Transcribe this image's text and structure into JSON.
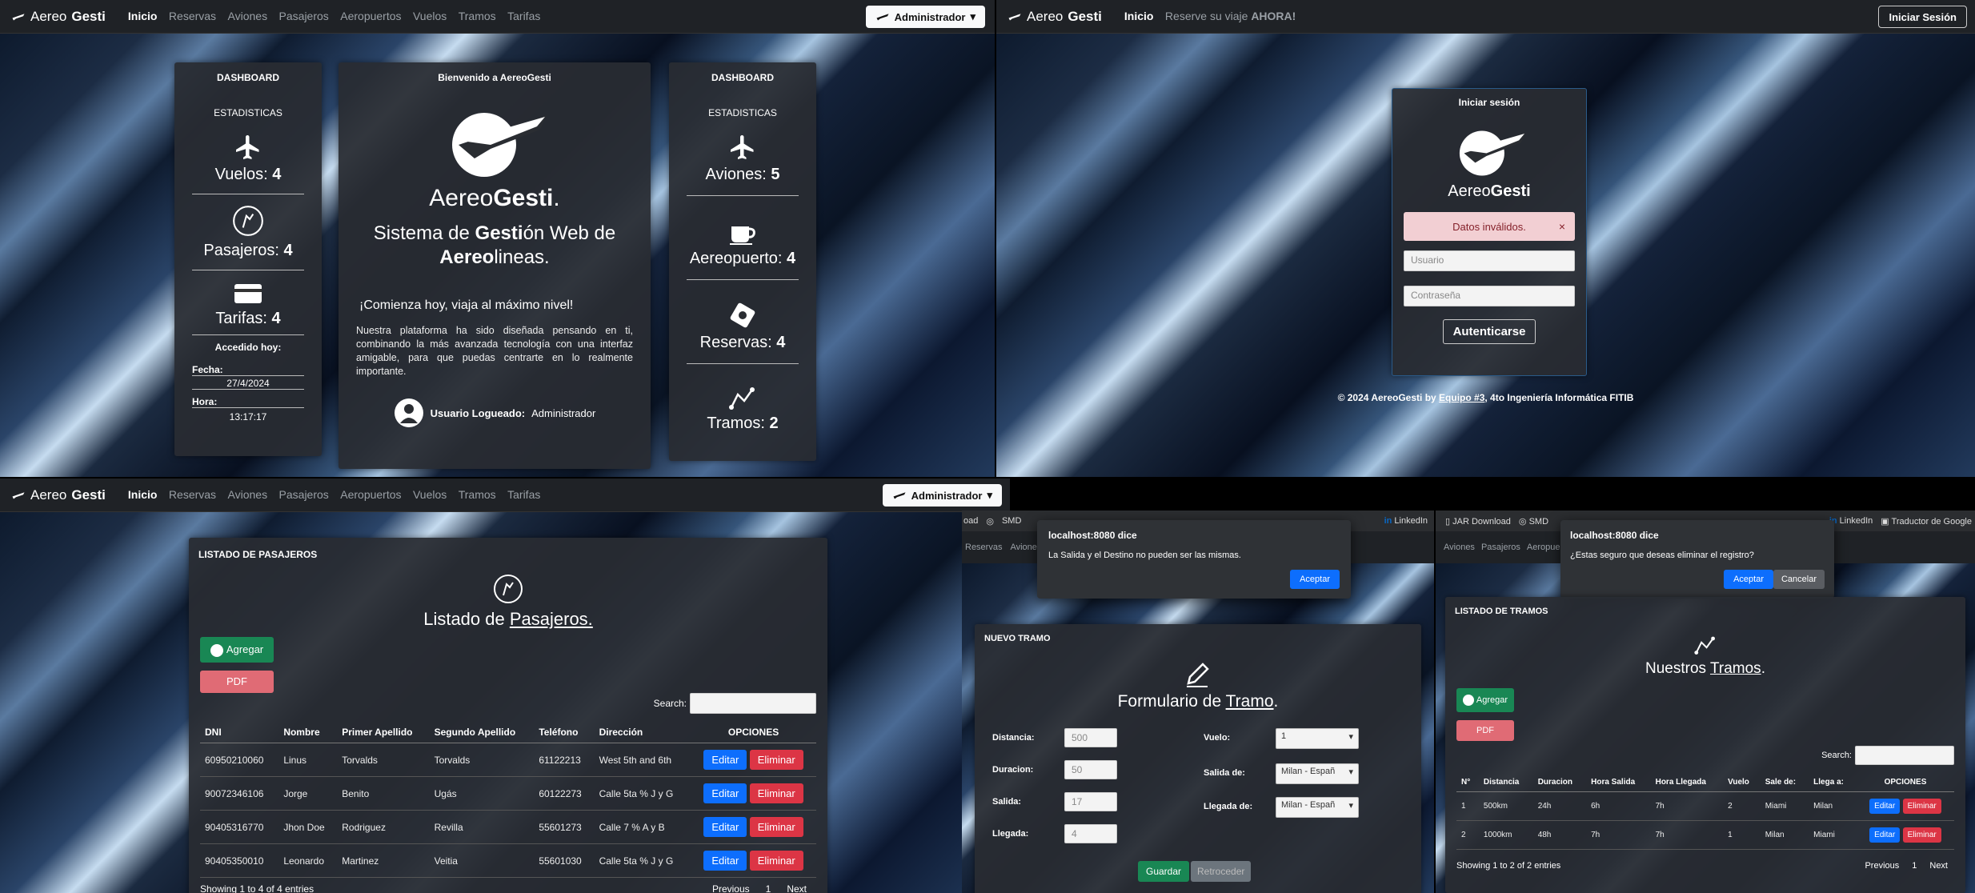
{
  "dashboard": {
    "brand": {
      "light": "Aereo",
      "bold": "Gesti"
    },
    "nav": [
      "Inicio",
      "Reservas",
      "Aviones",
      "Pasajeros",
      "Aeropuertos",
      "Vuelos",
      "Tramos",
      "Tarifas"
    ],
    "admin": "Administrador",
    "left": {
      "title": "DASHBOARD",
      "sub": "ESTADISTICAS",
      "vuelos_label": "Vuelos:",
      "vuelos": "4",
      "pasajeros_label": "Pasajeros:",
      "pasajeros": "4",
      "tarifas_label": "Tarifas:",
      "tarifas": "4",
      "accedido": "Accedido hoy:",
      "fecha_label": "Fecha:",
      "fecha": "27/4/2024",
      "hora_label": "Hora:",
      "hora": "13:17:17"
    },
    "center": {
      "welcome": "Bienvenido a AereoGesti",
      "logo_light": "Aereo",
      "logo_bold": "Gesti",
      "logo_dot": ".",
      "h1a": "Sistema de ",
      "h1b": "Gesti",
      "h1c": "ón Web de",
      "h2a": "Aereo",
      "h2b": "lineas.",
      "tagline": "¡Comienza hoy, viaja al máximo nivel!",
      "para": "Nuestra plataforma ha sido diseñada pensando en ti, combinando la más avanzada tecnología con una interfaz amigable, para que puedas centrarte en lo realmente importante.",
      "user_label": "Usuario Logueado:",
      "user": "Administrador"
    },
    "right": {
      "title": "DASHBOARD",
      "sub": "ESTADISTICAS",
      "aviones_label": "Aviones:",
      "aviones": "5",
      "aeropuerto_label": "Aereopuerto:",
      "aeropuerto": "4",
      "reservas_label": "Reservas:",
      "reservas": "4",
      "tramos_label": "Tramos:",
      "tramos": "2"
    }
  },
  "login": {
    "nav_home": "Inicio",
    "nav_promo_a": "Reserve su viaje ",
    "nav_promo_b": "AHORA!",
    "login_btn": "Iniciar Sesión",
    "title": "Iniciar sesión",
    "logo_light": "Aereo",
    "logo_bold": "Gesti",
    "error": "Datos inválidos.",
    "close": "×",
    "user_ph": "Usuario",
    "pass_ph": "Contraseña",
    "submit": "Autenticarse",
    "footer_a": "© 2024 AereoGesti by ",
    "footer_link": "Equipo #3",
    "footer_b": ", 4to Ingeniería Informática FITIB"
  },
  "pasajeros": {
    "card_title": "LISTADO DE PASAJEROS",
    "heading_a": "Listado de ",
    "heading_b": "Pasajeros.",
    "add": "Agregar",
    "pdf": "PDF",
    "search": "Search:",
    "columns": [
      "DNI",
      "Nombre",
      "Primer Apellido",
      "Segundo Apellido",
      "Teléfono",
      "Dirección",
      "OPCIONES"
    ],
    "rows": [
      [
        "60950210060",
        "Linus",
        "Torvalds",
        "Torvalds",
        "61122213",
        "West 5th and 6th"
      ],
      [
        "90072346106",
        "Jorge",
        "Benito",
        "Ugás",
        "60122273",
        "Calle 5ta % J y G"
      ],
      [
        "90405316770",
        "Jhon Doe",
        "Rodriguez",
        "Revilla",
        "55601273",
        "Calle 7 % A y B"
      ],
      [
        "90405350010",
        "Leonardo",
        "Martinez",
        "Veitia",
        "55601030",
        "Calle 5ta % J y G"
      ]
    ],
    "edit": "Editar",
    "delete": "Eliminar",
    "showing": "Showing 1 to 4 of 4 entries",
    "prev": "Previous",
    "page": "1",
    "next": "Next"
  },
  "tramo_form": {
    "bookmarks": [
      "oad",
      "SMD",
      "LinkedIn"
    ],
    "nav_partial": [
      "Reservas",
      "Aviones"
    ],
    "dialog_title": "localhost:8080 dice",
    "dialog_msg": "La Salida  y el Destino no pueden ser las mismas.",
    "dialog_ok": "Aceptar",
    "card_title": "NUEVO TRAMO",
    "heading_a": "Formulario de ",
    "heading_b": "Tramo",
    "heading_dot": ".",
    "distancia_label": "Distancia:",
    "distancia": "500",
    "duracion_label": "Duracion:",
    "duracion": "50",
    "salida_label": "Salida:",
    "salida": "17",
    "llegada_label": "Llegada:",
    "llegada": "4",
    "vuelo_label": "Vuelo:",
    "vuelo": "1",
    "salida_de_label": "Salida de:",
    "salida_de": "Milan - Españ",
    "llegada_de_label": "Llegada de:",
    "llegada_de": "Milan - Españ",
    "save": "Guardar",
    "back": "Retroceder"
  },
  "tramos_list": {
    "bookmarks": [
      "JAR Download",
      "SMD",
      "LinkedIn",
      "Traductor de Google"
    ],
    "nav_partial": [
      "Aviones",
      "Pasajeros",
      "Aeropuertos"
    ],
    "dialog_title": "localhost:8080 dice",
    "dialog_msg": "¿Estas seguro que deseas eliminar el registro?",
    "dialog_ok": "Aceptar",
    "dialog_cancel": "Cancelar",
    "card_title": "LISTADO DE TRAMOS",
    "heading_a": "Nuestros ",
    "heading_b": "Tramos",
    "add": "Agregar",
    "pdf": "PDF",
    "search": "Search:",
    "columns": [
      "N°",
      "Distancia",
      "Duracion",
      "Hora Salida",
      "Hora Llegada",
      "Vuelo",
      "Sale de:",
      "Llega a:",
      "OPCIONES"
    ],
    "rows": [
      [
        "1",
        "500km",
        "24h",
        "6h",
        "7h",
        "2",
        "Miami",
        "Milan"
      ],
      [
        "2",
        "1000km",
        "48h",
        "7h",
        "7h",
        "1",
        "Milan",
        "Miami"
      ]
    ],
    "edit": "Editar",
    "delete": "Eliminar",
    "showing": "Showing 1 to 2 of 2 entries",
    "prev": "Previous",
    "page": "1",
    "next": "Next"
  }
}
